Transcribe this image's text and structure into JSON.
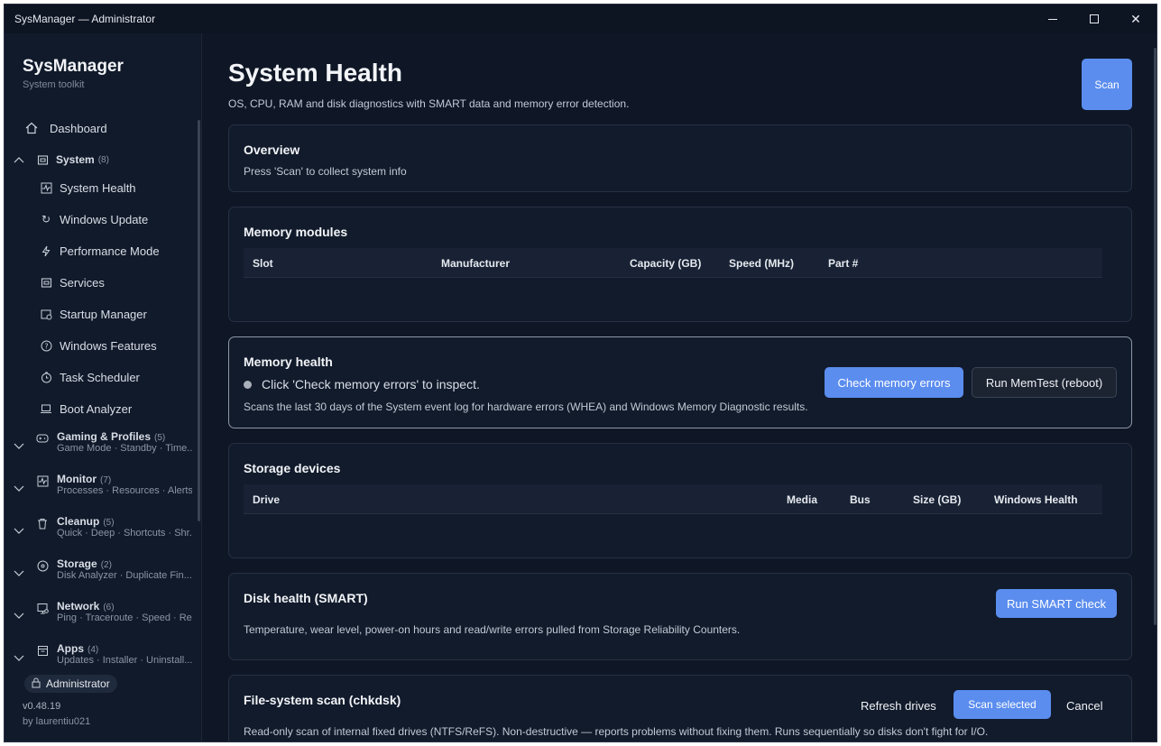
{
  "window": {
    "title": "SysManager — Administrator"
  },
  "sidebar": {
    "brand": "SysManager",
    "brand_sub": "System toolkit",
    "dashboard": "Dashboard",
    "system_group": {
      "title": "System",
      "count": "(8)"
    },
    "system_items": [
      "System Health",
      "Windows Update",
      "Performance Mode",
      "Services",
      "Startup Manager",
      "Windows Features",
      "Task Scheduler",
      "Boot Analyzer"
    ],
    "groups": [
      {
        "title": "Gaming & Profiles",
        "count": "(5)",
        "sub": "Game Mode · Standby · Time..."
      },
      {
        "title": "Monitor",
        "count": "(7)",
        "sub": "Processes · Resources · Alerts..."
      },
      {
        "title": "Cleanup",
        "count": "(5)",
        "sub": "Quick · Deep · Shortcuts · Shr..."
      },
      {
        "title": "Storage",
        "count": "(2)",
        "sub": "Disk Analyzer · Duplicate Fin..."
      },
      {
        "title": "Network",
        "count": "(6)",
        "sub": "Ping · Traceroute · Speed · Re..."
      },
      {
        "title": "Apps",
        "count": "(4)",
        "sub": "Updates · Installer · Uninstall..."
      }
    ],
    "admin_badge": "Administrator",
    "version": "v0.48.19",
    "author": "by laurentiu021"
  },
  "main": {
    "title": "System Health",
    "description": "OS, CPU, RAM and disk diagnostics with SMART data and memory error detection.",
    "scan_button": "Scan",
    "overview": {
      "title": "Overview",
      "text": "Press 'Scan' to collect system info"
    },
    "memory_modules": {
      "title": "Memory modules",
      "columns": [
        "Slot",
        "Manufacturer",
        "Capacity (GB)",
        "Speed (MHz)",
        "Part #"
      ]
    },
    "memory_health": {
      "title": "Memory health",
      "status": "Click 'Check memory errors' to inspect.",
      "description": "Scans the last 30 days of the System event log for hardware errors (WHEA) and Windows Memory Diagnostic results.",
      "check_button": "Check memory errors",
      "memtest_button": "Run MemTest (reboot)"
    },
    "storage_devices": {
      "title": "Storage devices",
      "columns": [
        "Drive",
        "Media",
        "Bus",
        "Size (GB)",
        "Windows Health"
      ]
    },
    "disk_health": {
      "title": "Disk health (SMART)",
      "description": "Temperature, wear level, power-on hours and read/write errors pulled from Storage Reliability Counters.",
      "button": "Run SMART check"
    },
    "fs_scan": {
      "title": "File-system scan (chkdsk)",
      "description": "Read-only scan of internal fixed drives (NTFS/ReFS). Non-destructive — reports problems without fixing them. Runs sequentially so disks don't fight for I/O.",
      "refresh_button": "Refresh drives",
      "scan_button": "Scan selected",
      "cancel_button": "Cancel"
    }
  },
  "colors": {
    "accent": "#5b8def",
    "background": "#0f1726",
    "card": "#121b2b"
  }
}
